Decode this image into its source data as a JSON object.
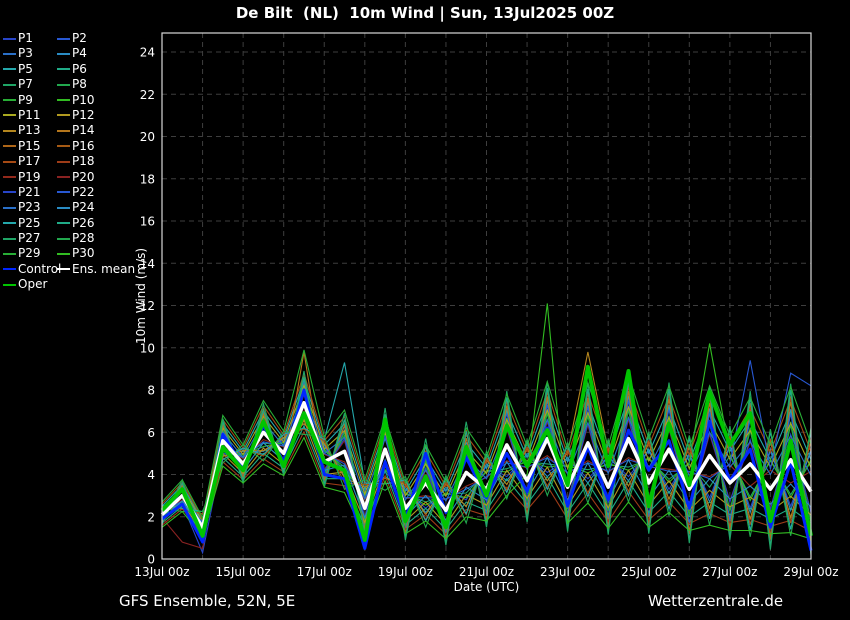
{
  "title": "De Bilt  (NL)  10m Wind | Sun, 13Jul2025 00Z",
  "footer": {
    "left": "GFS Ensemble, 52N, 5E",
    "right": "Wetterzentrale.de"
  },
  "legend": {
    "items": [
      {
        "label": "P1",
        "color": "#2845c8"
      },
      {
        "label": "P2",
        "color": "#2858d2"
      },
      {
        "label": "P3",
        "color": "#2a70c8"
      },
      {
        "label": "P4",
        "color": "#2a8cc4"
      },
      {
        "label": "P5",
        "color": "#24a8ac"
      },
      {
        "label": "P6",
        "color": "#20ac88"
      },
      {
        "label": "P7",
        "color": "#1fa566"
      },
      {
        "label": "P8",
        "color": "#22a84e"
      },
      {
        "label": "P9",
        "color": "#28ae36"
      },
      {
        "label": "P10",
        "color": "#32bc22"
      },
      {
        "label": "P11",
        "color": "#aaaa20"
      },
      {
        "label": "P12",
        "color": "#b29a20"
      },
      {
        "label": "P13",
        "color": "#b4861e"
      },
      {
        "label": "P14",
        "color": "#b4761c"
      },
      {
        "label": "P15",
        "color": "#ae6618"
      },
      {
        "label": "P16",
        "color": "#a65a14"
      },
      {
        "label": "P17",
        "color": "#a64a14"
      },
      {
        "label": "P18",
        "color": "#9e3c18"
      },
      {
        "label": "P19",
        "color": "#93291b"
      },
      {
        "label": "P20",
        "color": "#8a2222"
      },
      {
        "label": "P21",
        "color": "#2845c8"
      },
      {
        "label": "P22",
        "color": "#2858d2"
      },
      {
        "label": "P23",
        "color": "#2a70c8"
      },
      {
        "label": "P24",
        "color": "#2a8cc4"
      },
      {
        "label": "P25",
        "color": "#24a8ac"
      },
      {
        "label": "P26",
        "color": "#20ac88"
      },
      {
        "label": "P27",
        "color": "#1fa566"
      },
      {
        "label": "P28",
        "color": "#22a84e"
      },
      {
        "label": "P29",
        "color": "#28ae36"
      },
      {
        "label": "P30",
        "color": "#32bc22"
      },
      {
        "label": "Control",
        "color": "#0026ff"
      },
      {
        "label": "Ens. mean",
        "color": "#ffffff"
      },
      {
        "label": "Oper",
        "color": "#00c400"
      }
    ]
  },
  "chart_data": {
    "type": "line",
    "title": "De Bilt  (NL)  10m Wind | Sun, 13Jul2025 00Z",
    "xlabel": "Date (UTC)",
    "ylabel": "10m Wind (m/s)",
    "ylim": [
      0,
      24.9
    ],
    "grid": "dashed, vertical every 1 day, horizontal every 2 m/s",
    "legend_position": "top-left outside plot",
    "x_unit": "days since 13Jul2025 00Z",
    "x_range": [
      0,
      16
    ],
    "x_step": 0.5,
    "x_tick_days": [
      0,
      2,
      4,
      6,
      8,
      10,
      12,
      14,
      16
    ],
    "x_tick_labels": [
      "13Jul 00z",
      "15Jul 00z",
      "17Jul 00z",
      "19Jul 00z",
      "21Jul 00z",
      "23Jul 00z",
      "25Jul 00z",
      "27Jul 00z",
      "29Jul 00z"
    ],
    "y_ticks": [
      0,
      2,
      4,
      6,
      8,
      10,
      12,
      14,
      16,
      18,
      20,
      22,
      24
    ],
    "main_series": [
      {
        "name": "Control",
        "color": "#0026ff",
        "width": 3,
        "values": [
          1.9,
          2.6,
          0.8,
          5.9,
          4.4,
          6.3,
          4.6,
          8.0,
          4.0,
          3.8,
          0.5,
          4.6,
          1.9,
          5.0,
          2.2,
          4.8,
          2.9,
          5.0,
          3.2,
          6.2,
          2.5,
          5.3,
          2.8,
          6.1,
          4.2,
          5.6,
          2.4,
          6.5,
          3.7,
          5.2,
          1.5,
          4.6,
          0.4
        ]
      },
      {
        "name": "Ens. mean",
        "color": "#ffffff",
        "width": 3.5,
        "values": [
          2.1,
          3.0,
          1.5,
          5.6,
          4.5,
          6.0,
          5.0,
          7.4,
          4.6,
          5.1,
          2.4,
          5.2,
          2.4,
          3.6,
          2.3,
          4.1,
          3.3,
          5.4,
          3.7,
          5.7,
          3.4,
          5.5,
          3.4,
          5.7,
          3.6,
          5.2,
          3.3,
          4.9,
          3.6,
          4.5,
          3.3,
          4.7,
          3.2
        ]
      },
      {
        "name": "Oper",
        "color": "#00c400",
        "width": 4,
        "values": [
          2.3,
          3.3,
          1.1,
          5.3,
          4.2,
          6.5,
          4.4,
          6.9,
          4.6,
          4.2,
          0.9,
          6.6,
          1.8,
          3.9,
          1.5,
          5.3,
          3.0,
          6.3,
          4.4,
          6.1,
          3.5,
          9.1,
          4.4,
          8.9,
          2.5,
          6.4,
          3.5,
          7.9,
          5.4,
          6.9,
          1.8,
          5.6,
          1.1
        ]
      }
    ],
    "member_value_rule": "value[i] = ens_mean[i] + scale * pattern[i], clamped to >= 0.15, then overrides [index,value] applied",
    "member_patterns": {
      "A": [
        0.4,
        0.5,
        0.3,
        0.8,
        0.6,
        1.0,
        0.7,
        1.1,
        0.8,
        1.3,
        0.9,
        1.0,
        0.8,
        1.2,
        0.9,
        1.4,
        1.0,
        1.6,
        1.1,
        1.8,
        1.2,
        1.9,
        1.3,
        2.0,
        1.4,
        2.0,
        1.3,
        2.2,
        1.5,
        2.1,
        1.4,
        2.3,
        1.5
      ],
      "B": [
        -0.4,
        -0.5,
        -0.3,
        -0.8,
        -0.6,
        -1.0,
        -0.7,
        -1.1,
        -0.8,
        -1.3,
        -0.9,
        -1.0,
        -0.8,
        -1.2,
        -0.9,
        -1.4,
        -1.0,
        -1.6,
        -1.1,
        -1.8,
        -1.2,
        -1.9,
        -1.3,
        -2.0,
        -1.4,
        -2.0,
        -1.3,
        -2.2,
        -1.5,
        -2.1,
        -1.4,
        -2.3,
        -1.5
      ],
      "C": [
        0.3,
        -0.4,
        0.5,
        -0.6,
        0.5,
        -0.7,
        0.6,
        -0.8,
        0.7,
        -1.0,
        0.8,
        -1.1,
        0.9,
        -1.2,
        1.0,
        -1.3,
        1.1,
        -1.5,
        1.2,
        -1.6,
        1.3,
        -1.7,
        1.4,
        -1.8,
        1.5,
        -1.9,
        1.6,
        -2.0,
        1.7,
        -2.1,
        1.8,
        -2.2,
        1.9
      ],
      "D": [
        -0.3,
        0.4,
        -0.5,
        0.6,
        -0.5,
        0.7,
        -0.6,
        0.8,
        -0.7,
        1.0,
        -0.8,
        1.1,
        -0.9,
        1.2,
        -1.0,
        1.3,
        -1.1,
        1.5,
        -1.2,
        1.6,
        -1.3,
        1.7,
        -1.4,
        1.8,
        -1.5,
        1.9,
        -1.6,
        2.0,
        -1.7,
        2.1,
        -1.8,
        2.2,
        -1.9
      ],
      "E": [
        -0.2,
        0.5,
        -0.5,
        0.7,
        -0.6,
        0.9,
        -0.7,
        1.0,
        -0.8,
        1.2,
        -0.9,
        1.3,
        -1.0,
        1.4,
        -1.1,
        1.6,
        -1.2,
        1.7,
        -1.3,
        1.8,
        -1.4,
        1.9,
        -1.5,
        2.0,
        -1.6,
        2.1,
        -1.7,
        2.2,
        -1.8,
        2.3,
        -1.9,
        2.4,
        -2.0
      ],
      "F": [
        0.2,
        -0.5,
        0.5,
        -0.7,
        0.6,
        -0.9,
        0.7,
        -1.0,
        0.8,
        -1.2,
        0.9,
        -1.3,
        1.0,
        -1.4,
        1.1,
        -1.6,
        1.2,
        -1.7,
        1.3,
        -1.8,
        1.4,
        -1.9,
        1.5,
        -2.0,
        1.6,
        -2.1,
        1.7,
        -2.2,
        1.8,
        -2.3,
        1.9,
        -2.4,
        2.0
      ]
    },
    "members": [
      {
        "name": "P1",
        "color": "#2845c8",
        "pattern": "C",
        "scale": 1.0,
        "overrides": [
          [
            2,
            0.3
          ]
        ]
      },
      {
        "name": "P2",
        "color": "#2858d2",
        "pattern": "D",
        "scale": 1.0
      },
      {
        "name": "P3",
        "color": "#2a70c8",
        "pattern": "E",
        "scale": 1.0
      },
      {
        "name": "P4",
        "color": "#2a8cc4",
        "pattern": "F",
        "scale": 1.0
      },
      {
        "name": "P5",
        "color": "#24a8ac",
        "pattern": "A",
        "scale": 1.0
      },
      {
        "name": "P6",
        "color": "#20ac88",
        "pattern": "B",
        "scale": 1.0
      },
      {
        "name": "P7",
        "color": "#1fa566",
        "pattern": "C",
        "scale": 0.75
      },
      {
        "name": "P8",
        "color": "#22a84e",
        "pattern": "D",
        "scale": 0.75
      },
      {
        "name": "P9",
        "color": "#28ae36",
        "pattern": "E",
        "scale": 0.75
      },
      {
        "name": "P10",
        "color": "#32bc22",
        "pattern": "F",
        "scale": 0.75,
        "overrides": [
          [
            27,
            10.2
          ]
        ]
      },
      {
        "name": "P11",
        "color": "#aaaa20",
        "pattern": "A",
        "scale": 0.75
      },
      {
        "name": "P12",
        "color": "#b29a20",
        "pattern": "B",
        "scale": 0.75
      },
      {
        "name": "P13",
        "color": "#b4861e",
        "pattern": "C",
        "scale": 1.25,
        "overrides": [
          [
            21,
            9.8
          ]
        ]
      },
      {
        "name": "P14",
        "color": "#b4761c",
        "pattern": "D",
        "scale": 1.25,
        "overrides": [
          [
            7,
            9.8
          ]
        ]
      },
      {
        "name": "P15",
        "color": "#ae6618",
        "pattern": "E",
        "scale": 1.25
      },
      {
        "name": "P16",
        "color": "#a65a14",
        "pattern": "F",
        "scale": 1.25
      },
      {
        "name": "P17",
        "color": "#a64a14",
        "pattern": "A",
        "scale": 1.25
      },
      {
        "name": "P18",
        "color": "#9e3c18",
        "pattern": "B",
        "scale": 1.25
      },
      {
        "name": "P19",
        "color": "#93291b",
        "pattern": "C",
        "scale": 0.5
      },
      {
        "name": "P20",
        "color": "#8a2222",
        "pattern": "D",
        "scale": 0.5,
        "overrides": [
          [
            1,
            0.8
          ],
          [
            2,
            0.5
          ]
        ]
      },
      {
        "name": "P21",
        "color": "#2845c8",
        "pattern": "E",
        "scale": 0.5
      },
      {
        "name": "P22",
        "color": "#2858d2",
        "pattern": "F",
        "scale": 0.5,
        "overrides": [
          [
            29,
            9.4
          ],
          [
            31,
            8.8
          ],
          [
            32,
            8.2
          ]
        ]
      },
      {
        "name": "P23",
        "color": "#2a70c8",
        "pattern": "A",
        "scale": 0.5
      },
      {
        "name": "P24",
        "color": "#2a8cc4",
        "pattern": "B",
        "scale": 0.5
      },
      {
        "name": "P25",
        "color": "#24a8ac",
        "pattern": "C",
        "scale": 1.5,
        "overrides": [
          [
            9,
            9.3
          ]
        ]
      },
      {
        "name": "P26",
        "color": "#20ac88",
        "pattern": "D",
        "scale": 1.5
      },
      {
        "name": "P27",
        "color": "#1fa566",
        "pattern": "E",
        "scale": 1.5
      },
      {
        "name": "P28",
        "color": "#22a84e",
        "pattern": "F",
        "scale": 1.5
      },
      {
        "name": "P29",
        "color": "#28ae36",
        "pattern": "A",
        "scale": 1.5,
        "overrides": [
          [
            7,
            9.9
          ]
        ]
      },
      {
        "name": "P30",
        "color": "#32bc22",
        "pattern": "B",
        "scale": 1.5,
        "overrides": [
          [
            18,
            4.0
          ],
          [
            19,
            12.1
          ],
          [
            20,
            1.7
          ]
        ]
      }
    ]
  }
}
